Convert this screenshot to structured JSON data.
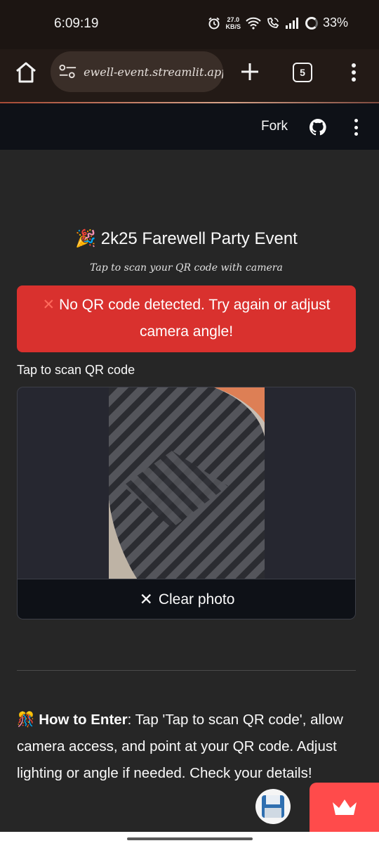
{
  "status_bar": {
    "time": "6:09:19",
    "net_speed_value": "27.0",
    "net_speed_unit": "KB/S",
    "battery": "33%"
  },
  "browser": {
    "url": "ewell-event.streamlit.app",
    "tab_count": "5"
  },
  "header": {
    "fork_label": "Fork"
  },
  "main": {
    "title_emoji": "🎉",
    "title": "2k25 Farewell Party Event",
    "subtitle": "Tap to scan your QR code with camera",
    "error_icon": "✕",
    "error_text": "No QR code detected. Try again or adjust camera angle!",
    "camera_label": "Tap to scan QR code",
    "clear_icon": "✕",
    "clear_label": "Clear photo",
    "howto_emoji": "🎊",
    "howto_heading": "How to Enter",
    "howto_text": ": Tap 'Tap to scan QR code', allow camera access, and point at your QR code. Adjust lighting or angle if needed. Check your details!"
  },
  "colors": {
    "error_bg": "#d9312e",
    "accent": "#ff4b4b",
    "header_bg": "#0e1117"
  }
}
